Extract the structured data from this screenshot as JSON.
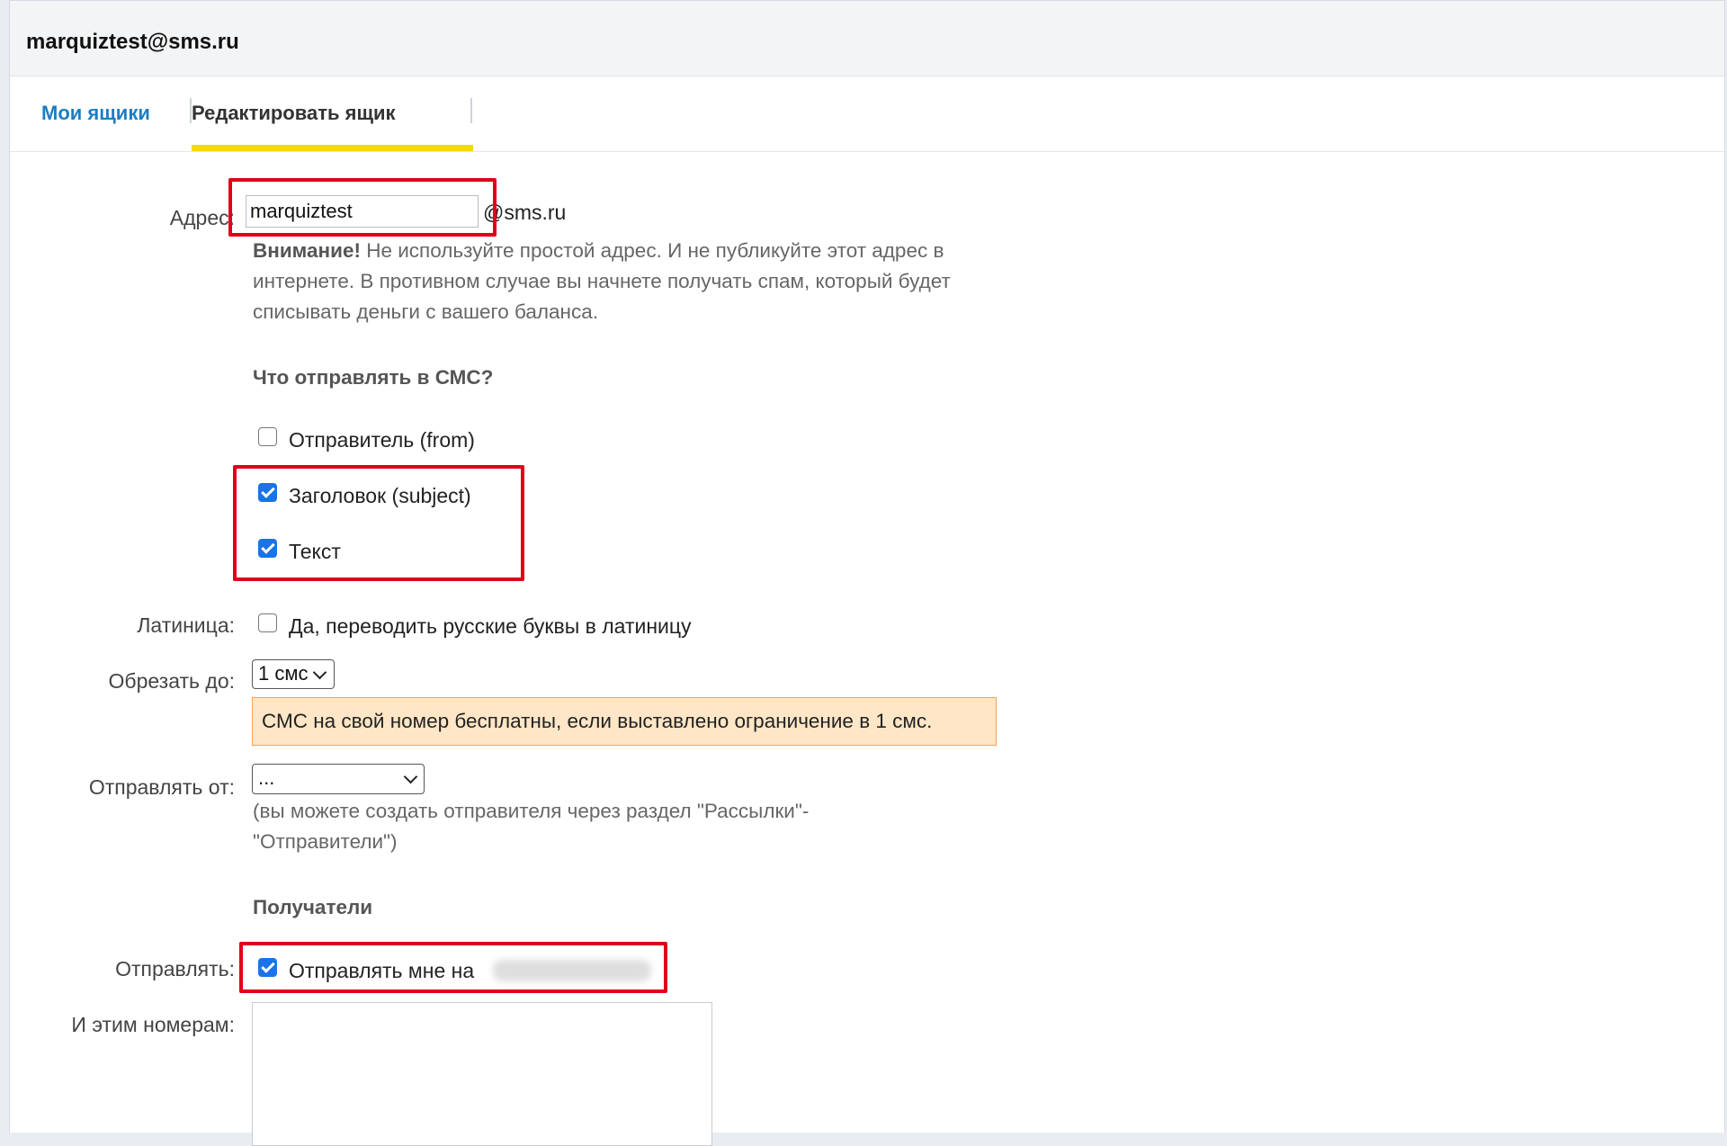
{
  "header": {
    "title": "marquiztest@sms.ru"
  },
  "tabs": [
    {
      "label": "Мои ящики",
      "active": false
    },
    {
      "label": "Редактировать ящик",
      "active": true
    }
  ],
  "form": {
    "address": {
      "label": "Адрес:",
      "value": "marquiztest",
      "domain": "@sms.ru"
    },
    "warning": {
      "strong": "Внимание!",
      "text": " Не используйте простой адрес. И не публикуйте этот адрес в интернете. В противном случае вы начнете получать спам, который будет списывать деньги с вашего баланса."
    },
    "what_to_send": {
      "heading": "Что отправлять в СМС?",
      "options": [
        {
          "label": "Отправитель (from)",
          "checked": false
        },
        {
          "label": "Заголовок (subject)",
          "checked": true
        },
        {
          "label": "Текст",
          "checked": true
        }
      ]
    },
    "latin": {
      "label": "Латиница:",
      "option": "Да, переводить русские буквы в латиницу",
      "checked": false
    },
    "truncate": {
      "label": "Обрезать до:",
      "selected": "1 смс",
      "notice": "СМС на свой номер бесплатны, если выставлено ограничение в 1 смс."
    },
    "send_from": {
      "label": "Отправлять от:",
      "selected": "...",
      "hint": "(вы можете создать отправителя через раздел \"Рассылки\"-\"Отправители\")"
    },
    "recipients": {
      "heading": "Получатели",
      "send_label": "Отправлять:",
      "send_me": "Отправлять мне на",
      "send_me_checked": true,
      "numbers_label": "И этим номерам:"
    }
  },
  "colors": {
    "link": "#1a7dc4",
    "tab_underline": "#f5d90b",
    "checkbox": "#1a73e8",
    "annotation": "#e0001a",
    "notice_bg": "#ffe6c6",
    "notice_border": "#f5a25a"
  }
}
